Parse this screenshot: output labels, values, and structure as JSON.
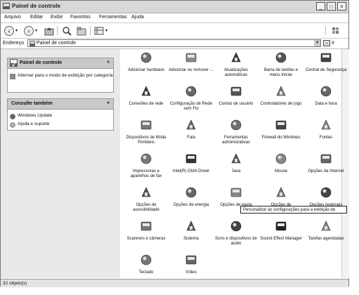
{
  "window": {
    "title": "Painel de controle"
  },
  "menu": [
    {
      "id": "arquivo",
      "label": "Arquivo"
    },
    {
      "id": "editar",
      "label": "Editar"
    },
    {
      "id": "exibir",
      "label": "Exibir"
    },
    {
      "id": "favoritos",
      "label": "Favoritos"
    },
    {
      "id": "ferramentas",
      "label": "Ferramentas"
    },
    {
      "id": "ajuda",
      "label": "Ajuda"
    }
  ],
  "address": {
    "label": "Endereço",
    "value": "Painel de controle",
    "go": "Ir"
  },
  "left": {
    "panel_title": "Painel de controle",
    "switch_link": "Alternar para o modo de exibição por categoria",
    "see_also_title": "Consulte também",
    "see_also": [
      {
        "label": "Windows Update"
      },
      {
        "label": "Ajuda e suporte"
      }
    ]
  },
  "items": [
    {
      "label": "Adicionar hardware",
      "icon": "hardware-icon",
      "color": "#707070"
    },
    {
      "label": "Adicionar ou remover ...",
      "icon": "add-remove-icon",
      "color": "#8a8a8a"
    },
    {
      "label": "Atualizações automáticas",
      "icon": "update-globe-icon",
      "color": "#333333"
    },
    {
      "label": "Barra de tarefas e menu Iniciar",
      "icon": "taskbar-icon",
      "color": "#555555"
    },
    {
      "label": "Central de Segurança",
      "icon": "shield-icon",
      "color": "#444444"
    },
    {
      "label": "Conexões de rede",
      "icon": "network-globe-icon",
      "color": "#3a3a3a"
    },
    {
      "label": "Configuração de Rede sem Fio",
      "icon": "wireless-icon",
      "color": "#666666"
    },
    {
      "label": "Contas de usuário",
      "icon": "users-icon",
      "color": "#555555"
    },
    {
      "label": "Controladores de jogo",
      "icon": "gamepad-icon",
      "color": "#777777"
    },
    {
      "label": "Data e hora",
      "icon": "clock-icon",
      "color": "#666666"
    },
    {
      "label": "Dispositivos de Mídia Portáteis",
      "icon": "media-device-icon",
      "color": "#777777"
    },
    {
      "label": "Fala",
      "icon": "speech-icon",
      "color": "#666666"
    },
    {
      "label": "Ferramentas administrativas",
      "icon": "admin-tools-icon",
      "color": "#707070"
    },
    {
      "label": "Firewall do Windows",
      "icon": "firewall-icon",
      "color": "#444444"
    },
    {
      "label": "Fontes",
      "icon": "fonts-folder-icon",
      "color": "#888888"
    },
    {
      "label": "Impressoras e aparelhos de fax",
      "icon": "printer-icon",
      "color": "#777777"
    },
    {
      "label": "Intel(R) GMA Driver",
      "icon": "intel-driver-icon",
      "color": "#333333"
    },
    {
      "label": "Java",
      "icon": "java-icon",
      "color": "#555555"
    },
    {
      "label": "Mouse",
      "icon": "mouse-icon",
      "color": "#888888"
    },
    {
      "label": "Opções da Internet",
      "icon": "internet-options-icon",
      "color": "#666666"
    },
    {
      "label": "Opções de acessibilidade",
      "icon": "accessibility-icon",
      "color": "#555555"
    },
    {
      "label": "Opções de energia",
      "icon": "power-icon",
      "color": "#666666"
    },
    {
      "label": "Opções de pasta",
      "icon": "folder-options-icon",
      "color": "#888888"
    },
    {
      "label": "Opções de",
      "icon": "phone-modem-icon",
      "color": "#777777"
    },
    {
      "label": "Opções regionais",
      "icon": "regional-globe-icon",
      "color": "#444444"
    },
    {
      "label": "Scanners e câmeras",
      "icon": "scanner-icon",
      "color": "#777777"
    },
    {
      "label": "Sistema",
      "icon": "system-icon",
      "color": "#555555"
    },
    {
      "label": "Sons e dispositivos de áudio",
      "icon": "speaker-icon",
      "color": "#444444"
    },
    {
      "label": "Sound Effect Manager",
      "icon": "sound-effect-icon",
      "color": "#222222"
    },
    {
      "label": "Tarefas agendadas",
      "icon": "scheduled-tasks-icon",
      "color": "#888888"
    },
    {
      "label": "Teclado",
      "icon": "keyboard-icon",
      "color": "#777777"
    },
    {
      "label": "Vídeo",
      "icon": "display-icon",
      "color": "#666666"
    }
  ],
  "tooltip": "Personalizar as configurações para a exibição de",
  "status": "32 objeto(s)"
}
